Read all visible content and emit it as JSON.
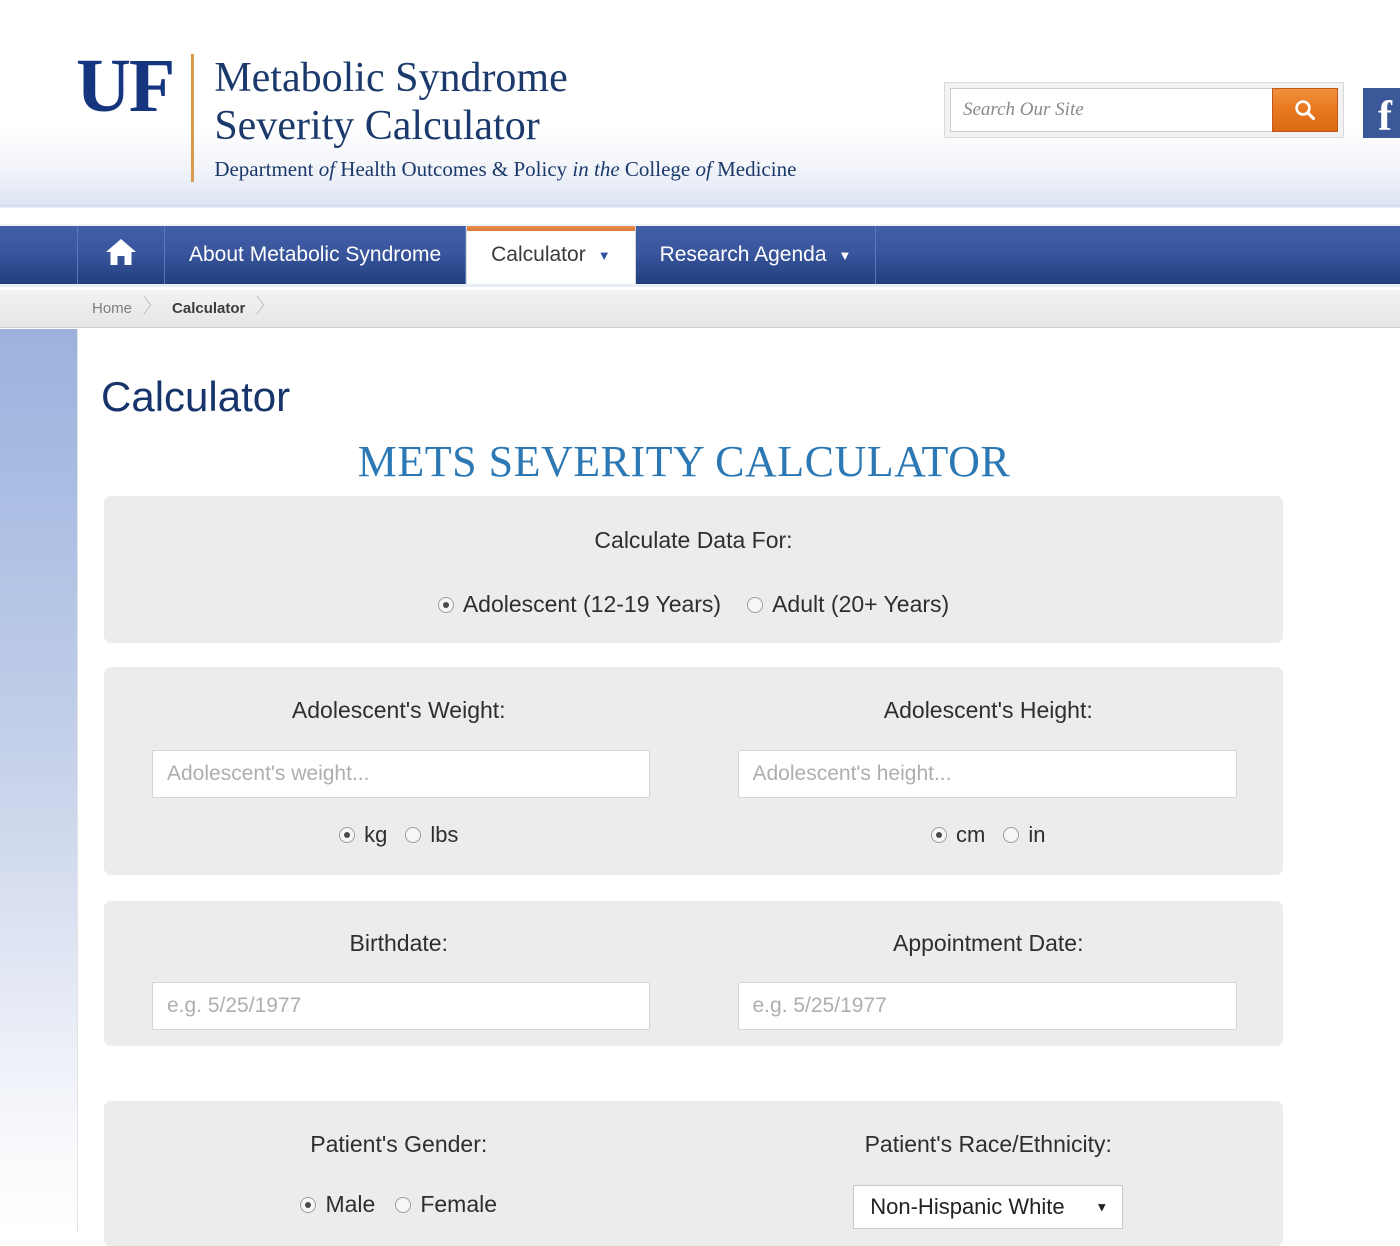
{
  "brand": {
    "logo_text": "UF",
    "line1": "Metabolic Syndrome",
    "line2": "Severity Calculator",
    "tagline_a": "Department ",
    "tagline_of1": "of",
    "tagline_b": " Health Outcomes & Policy ",
    "tagline_in": "in the",
    "tagline_c": " College ",
    "tagline_of2": "of",
    "tagline_d": " Medicine"
  },
  "search": {
    "placeholder": "Search Our Site",
    "value": "",
    "button_icon": "search-icon"
  },
  "social": {
    "facebook_glyph": "f"
  },
  "nav": {
    "home_icon": "home-icon",
    "items": [
      {
        "label": "About Metabolic Syndrome",
        "caret": "",
        "active": false
      },
      {
        "label": "Calculator",
        "caret": "▼",
        "active": true
      },
      {
        "label": "Research Agenda",
        "caret": "▼",
        "active": false
      }
    ]
  },
  "breadcrumb": {
    "items": [
      "Home",
      "Calculator"
    ]
  },
  "main": {
    "page_title": "Calculator",
    "calculator_title": "METS SEVERITY CALCULATOR"
  },
  "panel_audience": {
    "label": "Calculate Data For:",
    "options": [
      {
        "label": "Adolescent (12-19 Years)",
        "selected": true
      },
      {
        "label": "Adult (20+ Years)",
        "selected": false
      }
    ]
  },
  "panel_measurements": {
    "weight": {
      "label": "Adolescent's Weight:",
      "placeholder": "Adolescent's weight...",
      "value": "",
      "units": [
        {
          "label": "kg",
          "selected": true
        },
        {
          "label": "lbs",
          "selected": false
        }
      ]
    },
    "height": {
      "label": "Adolescent's Height:",
      "placeholder": "Adolescent's height...",
      "value": "",
      "units": [
        {
          "label": "cm",
          "selected": true
        },
        {
          "label": "in",
          "selected": false
        }
      ]
    }
  },
  "panel_dates": {
    "birthdate": {
      "label": "Birthdate:",
      "placeholder": "e.g. 5/25/1977",
      "value": ""
    },
    "appointment": {
      "label": "Appointment Date:",
      "placeholder": "e.g. 5/25/1977",
      "value": ""
    }
  },
  "panel_demographics": {
    "gender": {
      "label": "Patient's Gender:",
      "options": [
        {
          "label": "Male",
          "selected": true
        },
        {
          "label": "Female",
          "selected": false
        }
      ]
    },
    "race": {
      "label": "Patient's Race/Ethnicity:",
      "selected": "Non-Hispanic White",
      "caret": "▼"
    }
  },
  "colors": {
    "uf_blue": "#15367e",
    "nav_blue": "#3a569d",
    "accent_orange": "#e8771f",
    "title_blue": "#2b78b4",
    "panel_gray": "#ececec",
    "facebook_blue": "#3b5998"
  }
}
